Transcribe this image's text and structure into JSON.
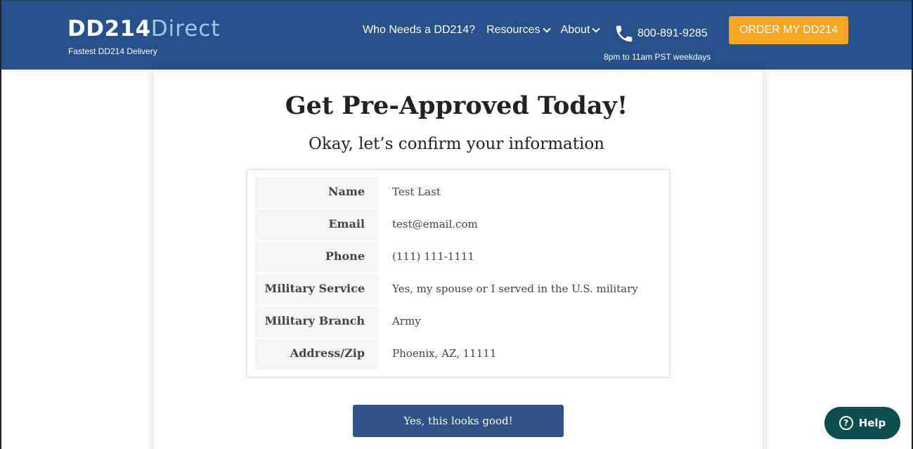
{
  "header": {
    "logo_main": "DD214",
    "logo_accent": "Direct",
    "tagline": "Fastest DD214 Delivery",
    "nav": [
      {
        "label": "Who Needs a DD214?",
        "dropdown": false
      },
      {
        "label": "Resources",
        "dropdown": true
      },
      {
        "label": "About",
        "dropdown": true
      }
    ],
    "phone": "800-891-9285",
    "hours": "8pm to 11am PST weekdays",
    "order_button": "ORDER MY DD214",
    "colors": {
      "bar": "#27518a",
      "order": "#f5a623",
      "accent": "#9ec8f0"
    }
  },
  "main": {
    "title": "Get Pre-Approved Today!",
    "subtitle": "Okay, let’s confirm your information",
    "rows": [
      {
        "label": "Name",
        "value": "Test Last"
      },
      {
        "label": "Email",
        "value": "test@email.com"
      },
      {
        "label": "Phone",
        "value": "(111) 111-1111"
      },
      {
        "label": "Military Service",
        "value": "Yes, my spouse or I served in the U.S. military"
      },
      {
        "label": "Military Branch",
        "value": "Army"
      },
      {
        "label": "Address/Zip",
        "value": "Phoenix, AZ, 11111"
      }
    ],
    "confirm_button": "Yes, this looks good!"
  },
  "help": {
    "label": "Help",
    "icon": "question-icon"
  }
}
